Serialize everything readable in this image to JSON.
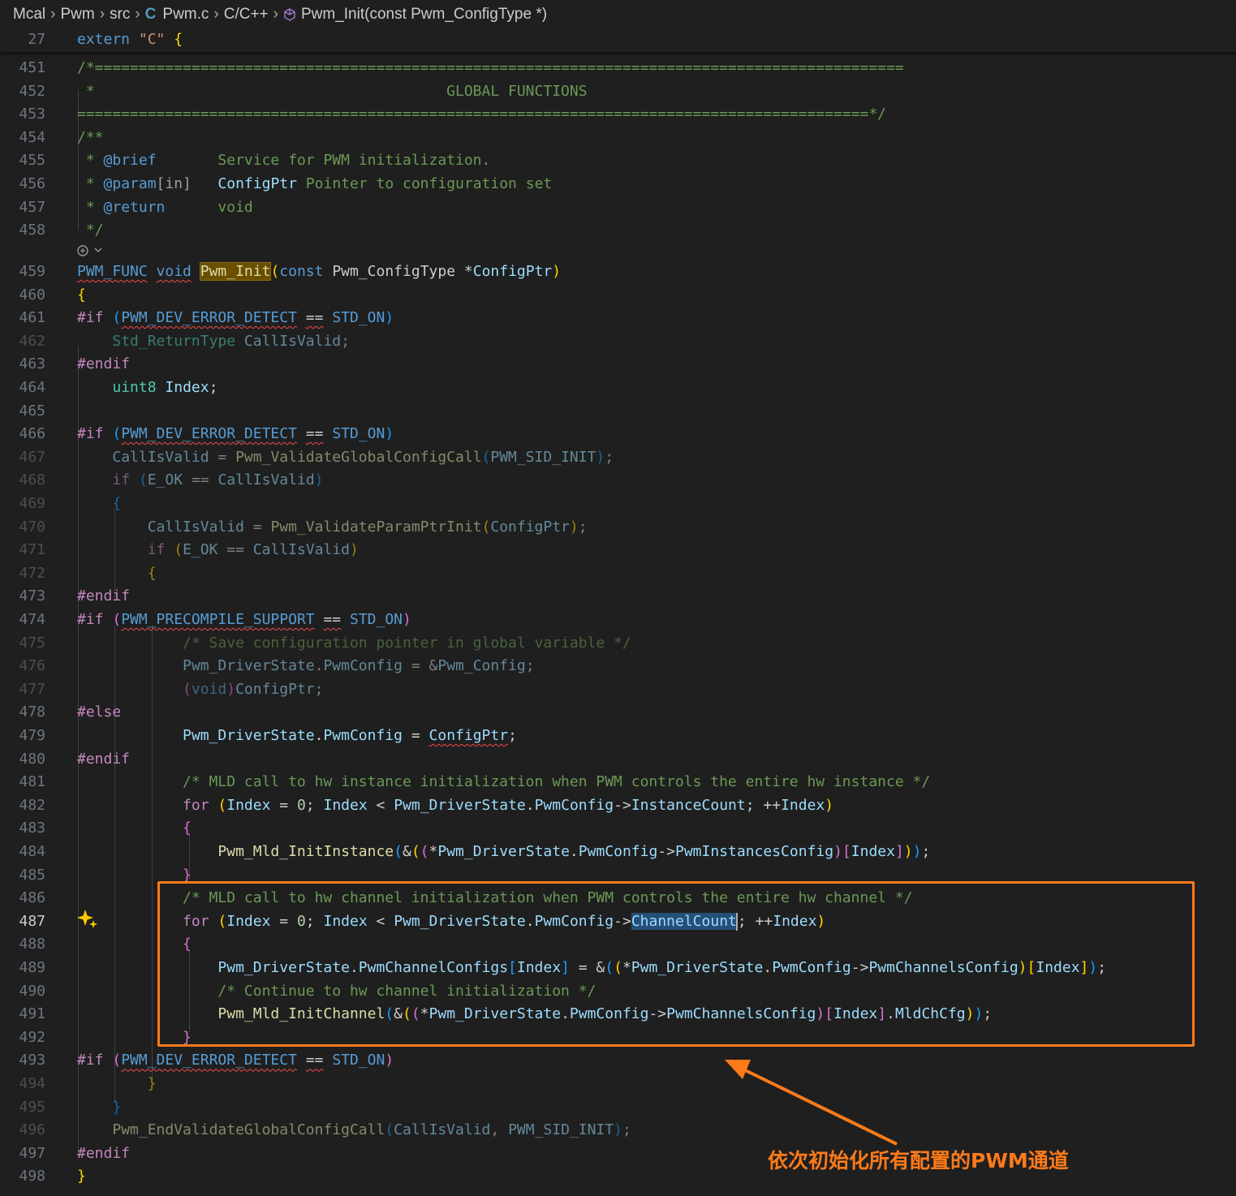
{
  "breadcrumb": {
    "items": [
      "Mcal",
      "Pwm",
      "src",
      "Pwm.c",
      "C/C++",
      "Pwm_Init(const Pwm_ConfigType *)"
    ],
    "file_icon": "C"
  },
  "sticky": {
    "line_number": "27",
    "code": "extern \"C\" {"
  },
  "lines": [
    {
      "n": "451"
    },
    {
      "n": "452"
    },
    {
      "n": "453"
    },
    {
      "n": "454"
    },
    {
      "n": "455"
    },
    {
      "n": "456"
    },
    {
      "n": "457"
    },
    {
      "n": "458"
    },
    {
      "n": "459"
    },
    {
      "n": "460"
    },
    {
      "n": "461"
    },
    {
      "n": "462"
    },
    {
      "n": "463"
    },
    {
      "n": "464"
    },
    {
      "n": "465"
    },
    {
      "n": "466"
    },
    {
      "n": "467"
    },
    {
      "n": "468"
    },
    {
      "n": "469"
    },
    {
      "n": "470"
    },
    {
      "n": "471"
    },
    {
      "n": "472"
    },
    {
      "n": "473"
    },
    {
      "n": "474"
    },
    {
      "n": "475"
    },
    {
      "n": "476"
    },
    {
      "n": "477"
    },
    {
      "n": "478"
    },
    {
      "n": "479"
    },
    {
      "n": "480"
    },
    {
      "n": "481"
    },
    {
      "n": "482"
    },
    {
      "n": "483"
    },
    {
      "n": "484"
    },
    {
      "n": "485"
    },
    {
      "n": "486"
    },
    {
      "n": "487"
    },
    {
      "n": "488"
    },
    {
      "n": "489"
    },
    {
      "n": "490"
    },
    {
      "n": "491"
    },
    {
      "n": "492"
    },
    {
      "n": "493"
    },
    {
      "n": "494"
    },
    {
      "n": "495"
    },
    {
      "n": "496"
    },
    {
      "n": "497"
    },
    {
      "n": "498"
    }
  ],
  "active_line": "487",
  "annotation": {
    "text": "依次初始化所有配置的PWM通道",
    "color": "#ff7a1a"
  },
  "colors": {
    "background": "#1f1f1f",
    "keyword": "#569cd6",
    "control": "#c586c0",
    "function": "#dcdcaa",
    "variable": "#9cdcfe",
    "comment": "#6a9955",
    "highlight_box": "#ff7a1a"
  },
  "icons": [
    "chevron-right-icon",
    "c-file-icon",
    "symbol-method-icon",
    "copilot-sparkle-icon",
    "codelens-chevron-icon"
  ]
}
